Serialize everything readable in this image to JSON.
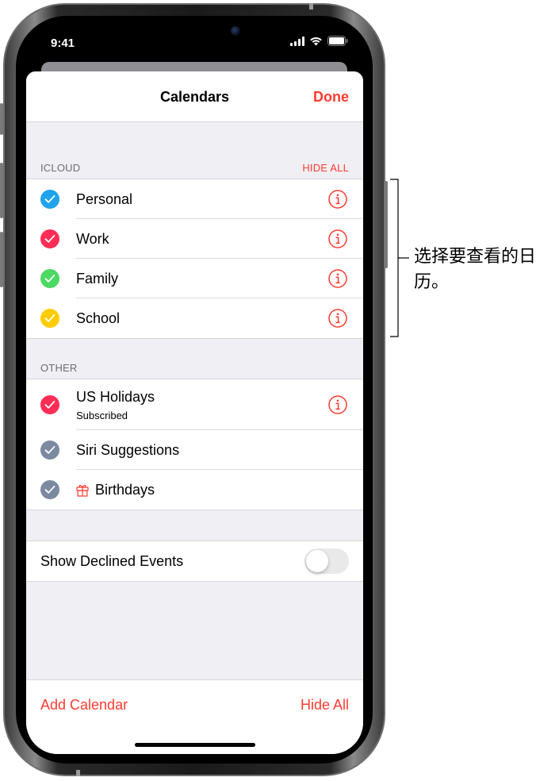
{
  "status_bar": {
    "time": "9:41"
  },
  "nav": {
    "title": "Calendars",
    "done_label": "Done"
  },
  "icloud": {
    "header": "ICLOUD",
    "action": "HIDE ALL",
    "items": [
      {
        "label": "Personal",
        "color": "#1fa3ec",
        "checked": true
      },
      {
        "label": "Work",
        "color": "#ff2d55",
        "checked": true
      },
      {
        "label": "Family",
        "color": "#4cd964",
        "checked": true
      },
      {
        "label": "School",
        "color": "#ffcc00",
        "checked": true
      }
    ]
  },
  "other": {
    "header": "OTHER",
    "items": [
      {
        "label": "US Holidays",
        "sublabel": "Subscribed",
        "color": "#ff2d55",
        "checked": true
      },
      {
        "label": "Siri Suggestions",
        "color": "#7b89a1",
        "checked": true
      },
      {
        "label": "Birthdays",
        "color": "#7b89a1",
        "checked": true,
        "icon": "gift-icon"
      }
    ]
  },
  "settings": {
    "show_declined_label": "Show Declined Events",
    "show_declined_on": false
  },
  "toolbar": {
    "add_label": "Add Calendar",
    "hide_all_label": "Hide All"
  },
  "callout": {
    "text": "选择要查看的日历。"
  },
  "colors": {
    "accent": "#ff3b30",
    "background": "#efeff4"
  }
}
